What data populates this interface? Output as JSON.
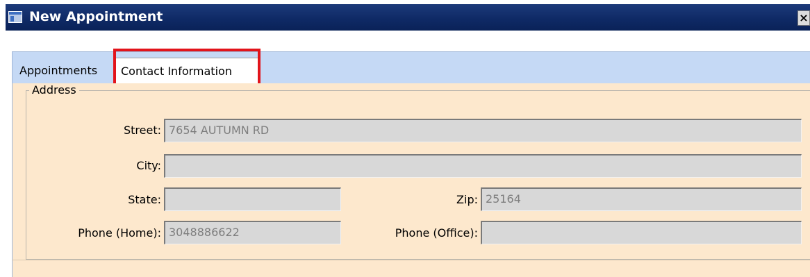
{
  "window": {
    "title": "New Appointment",
    "close_label": "×"
  },
  "tabs": [
    {
      "label": "Appointments",
      "selected": false
    },
    {
      "label": "Contact Information",
      "selected": true,
      "highlighted": true
    }
  ],
  "address_group": {
    "legend": "Address",
    "street": {
      "label": "Street:",
      "value": "7654 AUTUMN RD"
    },
    "city": {
      "label": "City:",
      "value": ""
    },
    "state": {
      "label": "State:",
      "value": ""
    },
    "zip": {
      "label": "Zip:",
      "value": "25164"
    },
    "phone_home": {
      "label": "Phone (Home):",
      "value": "3048886622"
    },
    "phone_office": {
      "label": "Phone (Office):",
      "value": ""
    }
  },
  "colors": {
    "titlebar": "#0f2a66",
    "tabstrip": "#c5d9f5",
    "panel_background": "#fde8cd",
    "input_background": "#d8d8d8",
    "highlight_border": "#e2141b"
  },
  "icons": {
    "window_icon": "window-icon",
    "close": "close-icon"
  }
}
